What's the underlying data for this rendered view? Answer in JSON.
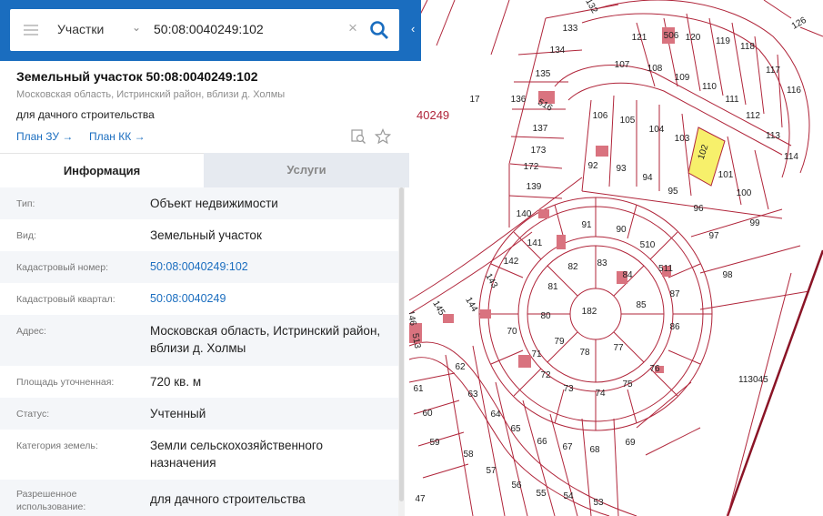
{
  "search": {
    "layer": "Участки",
    "query": "50:08:0040249:102"
  },
  "card": {
    "title": "Земельный участок 50:08:0040249:102",
    "address": "Московская область, Истринский район, вблизи д. Холмы",
    "use": "для дачного строительства",
    "link_zu": "План ЗУ →",
    "link_kk": "План КК →"
  },
  "tabs": {
    "info": "Информация",
    "services": "Услуги"
  },
  "rows": [
    {
      "label": "Тип:",
      "value": "Объект недвижимости"
    },
    {
      "label": "Вид:",
      "value": "Земельный участок"
    },
    {
      "label": "Кадастровый номер:",
      "value": "50:08:0040249:102"
    },
    {
      "label": "Кадастровый квартал:",
      "value": "50:08:0040249"
    },
    {
      "label": "Адрес:",
      "value": "Московская область, Истринский район, вблизи д. Холмы"
    },
    {
      "label": "Площадь уточненная:",
      "value": "720 кв. м"
    },
    {
      "label": "Статус:",
      "value": "Учтенный"
    },
    {
      "label": "Категория земель:",
      "value": "Земли сельскохозяйственного назначения"
    },
    {
      "label": "Разрешенное использование:",
      "value": "для дачного строительства"
    }
  ],
  "map": {
    "quarter_label": "40249",
    "quarter_label_2": "113045",
    "parcel_numbers": [
      "121",
      "506",
      "120",
      "119",
      "118",
      "117",
      "116",
      "107",
      "108",
      "109",
      "110",
      "111",
      "112",
      "113",
      "114",
      "106",
      "105",
      "104",
      "103",
      "102",
      "101",
      "100",
      "99",
      "92",
      "93",
      "94",
      "95",
      "96",
      "97",
      "98",
      "91",
      "90",
      "510",
      "511",
      "84",
      "83",
      "82",
      "81",
      "85",
      "87",
      "86",
      "182",
      "80",
      "70",
      "79",
      "78",
      "77",
      "76",
      "75",
      "74",
      "73",
      "72",
      "71",
      "62",
      "63",
      "64",
      "65",
      "66",
      "67",
      "68",
      "69",
      "61",
      "60",
      "59",
      "58",
      "57",
      "56",
      "55",
      "54",
      "53",
      "47",
      "133",
      "134",
      "135",
      "136",
      "516",
      "137",
      "173",
      "172",
      "139",
      "140",
      "141",
      "142",
      "143",
      "144",
      "145",
      "146",
      "513",
      "17",
      "132",
      "126"
    ],
    "selected_parcel": "102",
    "colors": {
      "parcel_line": "#b0253a",
      "selected_fill": "#f7f06b",
      "blue": "#1a6dbf"
    }
  }
}
